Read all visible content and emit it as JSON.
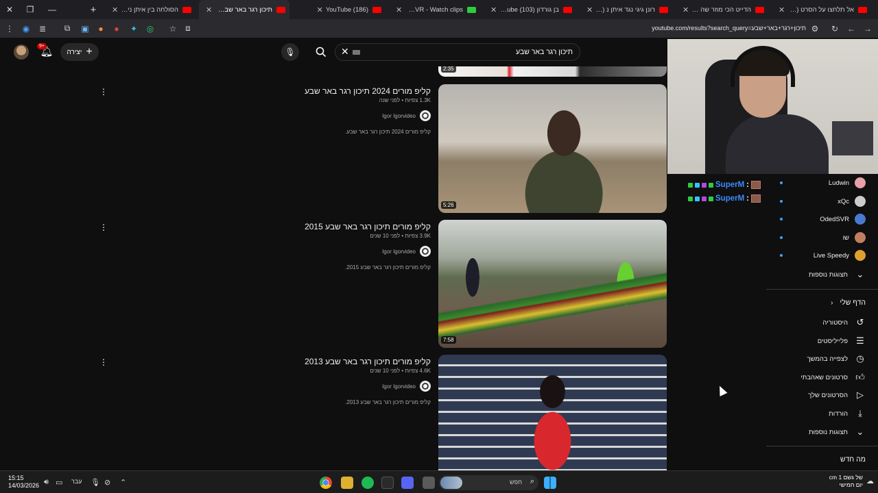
{
  "browser": {
    "tabs": [
      {
        "title": "אל תלחצו על הסרט (103)",
        "icon": "youtube-favicon"
      },
      {
        "title": "הדייט הכי מוזר שה (103)",
        "icon": "youtube-favicon"
      },
      {
        "title": "רונן גיגי נגד איתן נ (103)",
        "icon": "youtube-favicon"
      },
      {
        "title": "בן גורדון (103) YouTube",
        "icon": "youtube-favicon"
      },
      {
        "title": "OdedSVR - Watch clips",
        "icon": "kick-favicon"
      },
      {
        "title": "(186) YouTube",
        "icon": "youtube-favicon"
      },
      {
        "title": "תיכון רגר באר שבע (185)",
        "icon": "youtube-favicon",
        "active": true
      },
      {
        "title": "הסולחה בין איתן ניסים לר",
        "icon": "youtube-favicon"
      }
    ],
    "url": "youtube.com/results?search_query=תיכון+רגר+באר+שבע"
  },
  "masthead": {
    "search_query": "תיכון רגר באר שבע",
    "create_label": "יצירה",
    "notification_count": "9+"
  },
  "results": [
    {
      "title": "קליפ מורים 2024 תיכון רגר באר שבע",
      "views": "1.3K צפיות",
      "age": "לפני שנה",
      "channel": "Igor Igorvideo",
      "description": "קליפ מורים 2024 תיכון רגר באר שבע.",
      "duration": "5:26"
    },
    {
      "title": "קליפ מורים תיכון רגר באר שבע 2015",
      "views": "3.9K צפיות",
      "age": "לפני 10 שנים",
      "channel": "Igor Igorvideo",
      "description": "קליפ מורים תיכון רגר באר שבע 2015.",
      "duration": "7:58"
    },
    {
      "title": "קליפ מורים תיכון רגר באר שבע 2013",
      "views": "4.6K צפיות",
      "age": "לפני 10 שנים",
      "channel": "Igor Igorvideo",
      "description": "קליפ מורים תיכון רגר באר שבע 2013.",
      "duration": ""
    }
  ],
  "top_partial_duration": "2:35",
  "sidebar": {
    "subscriptions": [
      {
        "name": "Ludwin",
        "color": "#e8a0a8"
      },
      {
        "name": "xQc",
        "color": "#cccccc"
      },
      {
        "name": "OdedSVR",
        "color": "#4a7ad0"
      },
      {
        "name": "שו",
        "color": "#c08060"
      },
      {
        "name": "Live Speedy",
        "color": "#e0a030"
      }
    ],
    "show_more_1": "תצוגות נוספות",
    "you_section": "הדף שלי",
    "you_items": [
      {
        "label": "היסטוריה",
        "icon": "history-icon"
      },
      {
        "label": "פלייליסטים",
        "icon": "playlists-icon"
      },
      {
        "label": "לצפייה בהמשך",
        "icon": "watch-later-icon"
      },
      {
        "label": "סרטונים שאהבתי",
        "icon": "like-icon"
      },
      {
        "label": "הסרטונים שלך",
        "icon": "your-videos-icon"
      },
      {
        "label": "הורדות",
        "icon": "download-icon"
      }
    ],
    "show_more_2": "תצוגות נוספות",
    "whats_new": "מה חדש"
  },
  "chat": [
    {
      "user": "SuperM",
      "sep": ":"
    },
    {
      "user": "SuperM",
      "sep": ":"
    }
  ],
  "taskbar": {
    "time": "15:15",
    "date": "14/03/2026",
    "lang": "עבר",
    "search_placeholder": "חפש",
    "weather_line1": "של גשם 1 cm",
    "weather_line2": "יום חמישי"
  }
}
